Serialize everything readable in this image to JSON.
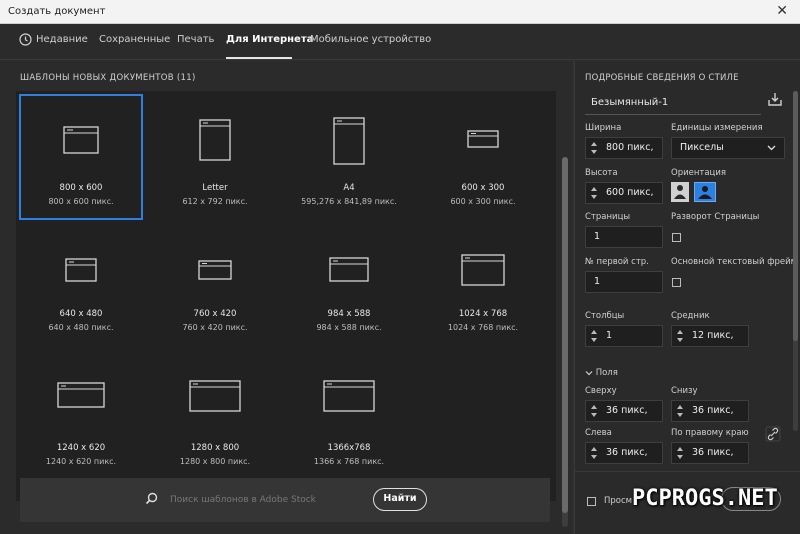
{
  "window": {
    "title": "Создать документ"
  },
  "tabs": [
    {
      "label": "Недавние"
    },
    {
      "label": "Сохраненные"
    },
    {
      "label": "Печать"
    },
    {
      "label": "Для Интернета"
    },
    {
      "label": "Мобильное устройство"
    }
  ],
  "templates": {
    "header": "ШАБЛОНЫ НОВЫХ ДОКУМЕНТОВ",
    "count": "(11)",
    "items": [
      {
        "name": "800 x 600",
        "size": "800 x 600 пикс.",
        "icon": "browser-window-icon"
      },
      {
        "name": "Letter",
        "size": "612 x 792 пикс.",
        "icon": "portrait-page-icon"
      },
      {
        "name": "A4",
        "size": "595,276 x 841,89 пикс.",
        "icon": "portrait-page-icon"
      },
      {
        "name": "600 x 300",
        "size": "600 x 300 пикс.",
        "icon": "browser-window-icon"
      },
      {
        "name": "640 x 480",
        "size": "640 x 480 пикс.",
        "icon": "browser-window-icon"
      },
      {
        "name": "760 x 420",
        "size": "760 x 420 пикс.",
        "icon": "browser-window-icon"
      },
      {
        "name": "984 x 588",
        "size": "984 x 588 пикс.",
        "icon": "browser-window-icon"
      },
      {
        "name": "1024 x 768",
        "size": "1024 x 768 пикс.",
        "icon": "browser-window-icon"
      },
      {
        "name": "1240 x 620",
        "size": "1240 x 620 пикс.",
        "icon": "browser-window-icon"
      },
      {
        "name": "1280 x 800",
        "size": "1280 x 800 пикс.",
        "icon": "browser-window-icon"
      },
      {
        "name": "1366x768",
        "size": "1366 x 768 пикс.",
        "icon": "browser-window-icon"
      }
    ]
  },
  "search": {
    "placeholder": "Поиск шаблонов в Adobe Stock",
    "button": "Найти"
  },
  "details": {
    "header": "ПОДРОБНЫЕ СВЕДЕНИЯ О СТИЛЕ",
    "doc_name": "Безымянный-1",
    "width_label": "Ширина",
    "width_value": "800 пикс,",
    "units_label": "Единицы измерения",
    "units_value": "Пикселы",
    "height_label": "Высота",
    "height_value": "600 пикс,",
    "orientation_label": "Ориентация",
    "pages_label": "Страницы",
    "pages_value": "1",
    "spread_label": "Разворот Страницы",
    "first_page_label": "№ первой стр.",
    "first_page_value": "1",
    "primary_frame_label": "Основной текстовый фрейм",
    "columns_label": "Столбцы",
    "columns_value": "1",
    "gutter_label": "Средник",
    "gutter_value": "12 пикс,",
    "margins_label": "Поля",
    "top_label": "Сверху",
    "top_value": "36 пикс,",
    "bottom_label": "Снизу",
    "bottom_value": "36 пикс,",
    "left_label": "Слева",
    "left_value": "36 пикс,",
    "right_label": "По правому краю",
    "right_value": "36 пикс,",
    "preview_label": "Просм"
  },
  "watermark": "PCPROGS.NET",
  "colors": {
    "accent": "#2d7fe0",
    "background": "#2b2b2b"
  }
}
